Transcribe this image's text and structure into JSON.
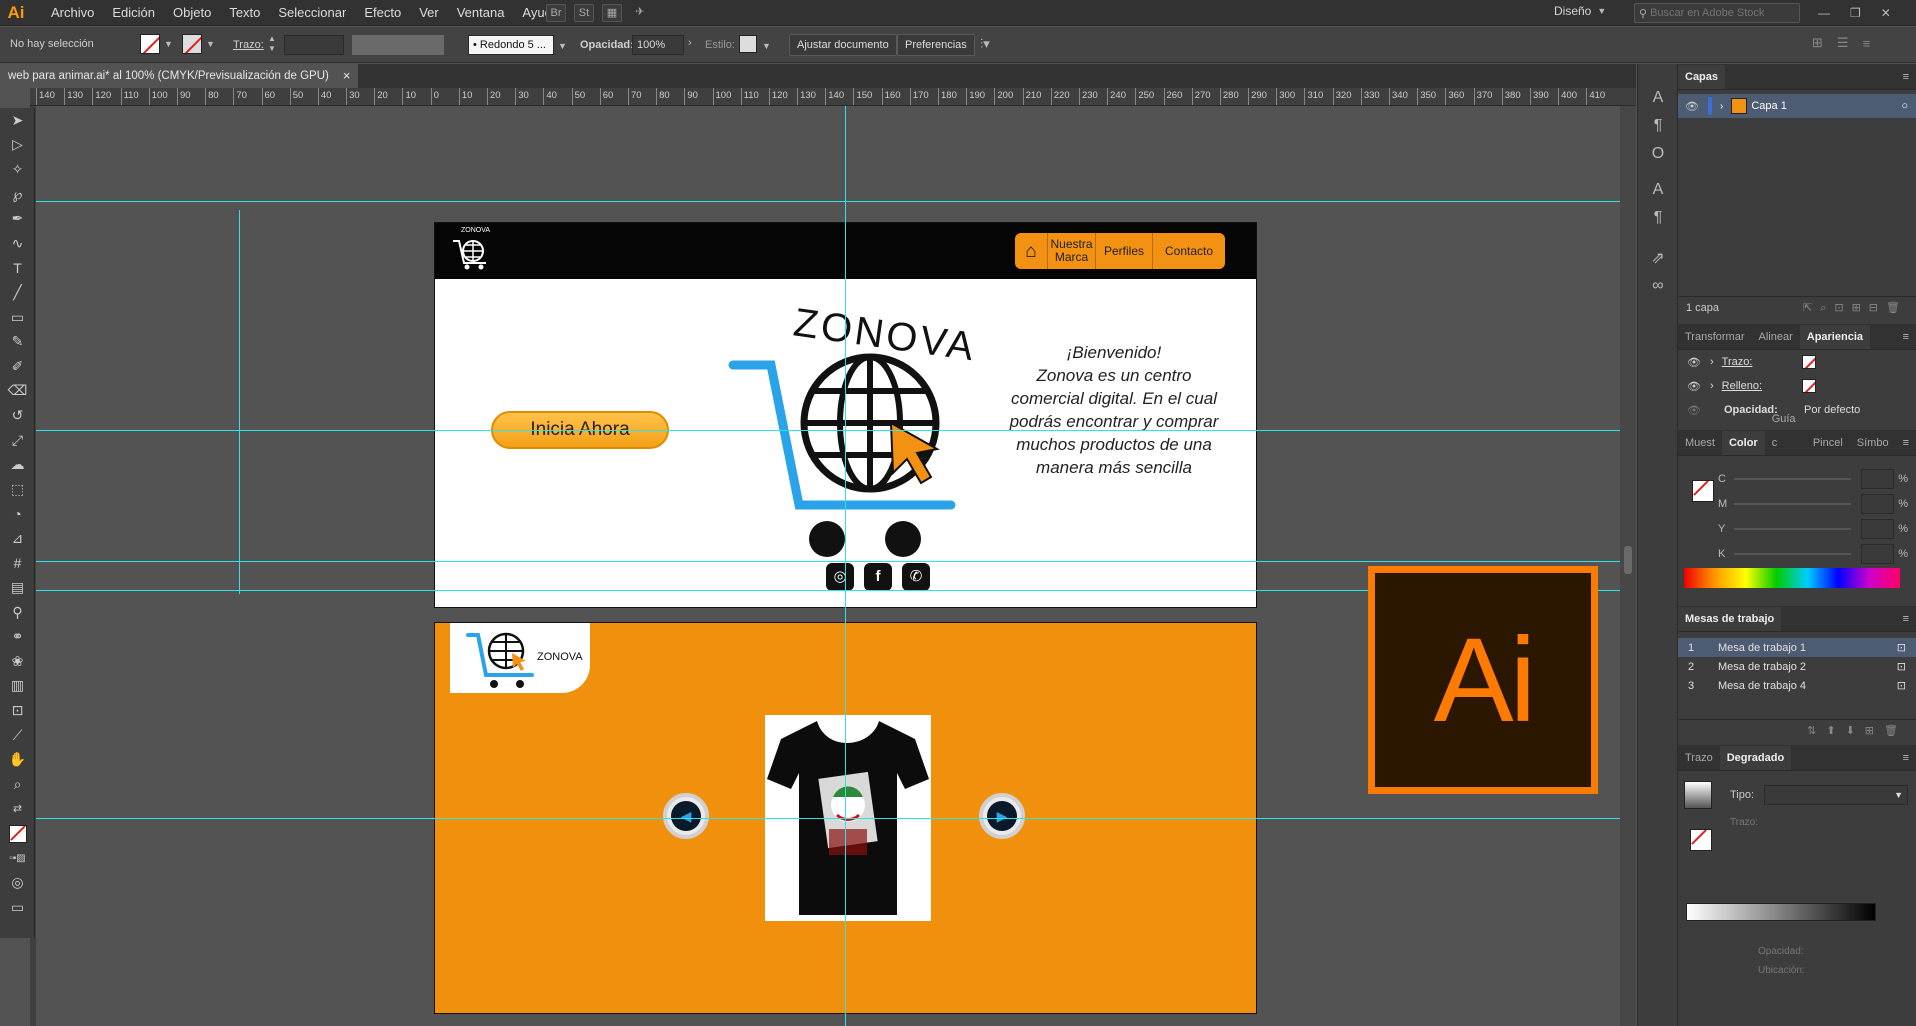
{
  "app": {
    "logo": "Ai",
    "menu": [
      "Archivo",
      "Edición",
      "Objeto",
      "Texto",
      "Seleccionar",
      "Efecto",
      "Ver",
      "Ventana",
      "Ayuda"
    ],
    "workspace": "Diseño",
    "search_placeholder": "Buscar en Adobe Stock",
    "bridge_label": "Br",
    "stock_label": "St"
  },
  "control": {
    "selection": "No hay selección",
    "stroke_label": "Trazo:",
    "brush": "Redondo 5 ...",
    "opacity_label": "Opacidad:",
    "opacity_value": "100%",
    "style_label": "Estilo:",
    "fit_button": "Ajustar documento",
    "prefs_button": "Preferencias"
  },
  "document": {
    "tab_title": "web para animar.ai* al 100% (CMYK/Previsualización de GPU)",
    "close": "×"
  },
  "ruler": {
    "ticks": [
      "140",
      "130",
      "120",
      "110",
      "100",
      "90",
      "80",
      "70",
      "60",
      "50",
      "40",
      "30",
      "20",
      "10",
      "0",
      "10",
      "20",
      "30",
      "40",
      "50",
      "60",
      "70",
      "80",
      "90",
      "100",
      "110",
      "120",
      "130",
      "140",
      "150",
      "160",
      "170",
      "180",
      "190",
      "200",
      "210",
      "220",
      "230",
      "240",
      "250",
      "260",
      "270",
      "280",
      "290",
      "300",
      "310",
      "320",
      "330",
      "340",
      "350",
      "360",
      "370",
      "380",
      "390",
      "400",
      "410"
    ]
  },
  "artboard1": {
    "nav": [
      "Nuestra Marca",
      "Perfiles",
      "Contacto"
    ],
    "cta": "Inicia Ahora",
    "wordmark": "ZONOVA",
    "welcome_title": "¡Bienvenido!",
    "welcome_text": "Zonova es un centro comercial digital. En el cual podrás encontrar y comprar muchos productos de una manera más sencilla",
    "header_logo_text": "ZONOVA"
  },
  "artboard2": {
    "logo_text": "ZONOVA"
  },
  "badge": {
    "text": "Ai"
  },
  "layers": {
    "tab": "Capas",
    "items": [
      {
        "name": "Capa 1"
      }
    ],
    "count": "1 capa"
  },
  "appearance": {
    "tabs": [
      "Transformar",
      "Alinear",
      "Apariencia"
    ],
    "rows": [
      {
        "label": "Trazo:"
      },
      {
        "label": "Relleno:"
      },
      {
        "label": "Opacidad:",
        "value": "Por defecto"
      }
    ]
  },
  "color": {
    "tabs": [
      "Muest",
      "Color",
      "Guía c",
      "Pincel",
      "Símbo"
    ],
    "channels": [
      "C",
      "M",
      "Y",
      "K"
    ],
    "unit": "%"
  },
  "artboards_panel": {
    "title": "Mesas de trabajo",
    "items": [
      {
        "num": "1",
        "name": "Mesa de trabajo 1"
      },
      {
        "num": "2",
        "name": "Mesa de trabajo 2"
      },
      {
        "num": "3",
        "name": "Mesa de trabajo 4"
      }
    ]
  },
  "gradient": {
    "tabs": [
      "Trazo",
      "Degradado"
    ],
    "type_label": "Tipo:",
    "stroke_label": "Trazo:",
    "opacity_label": "Opacidad:",
    "location_label": "Ubicación:"
  },
  "colors": {
    "accent_orange": "#f39112",
    "guide": "#2ee3e3",
    "selection_blue": "#4d5c73",
    "cart_blue": "#2aa3e8"
  },
  "icons": [
    "selection-tool-icon",
    "direct-selection-icon",
    "magic-wand-icon",
    "lasso-icon",
    "pen-icon",
    "curvature-icon",
    "type-icon",
    "line-icon",
    "rectangle-icon",
    "paintbrush-icon",
    "shaper-icon",
    "eraser-icon",
    "rotate-icon",
    "scale-icon",
    "warp-icon",
    "free-transform-icon",
    "shape-builder-icon",
    "perspective-icon",
    "mesh-icon",
    "gradient-icon",
    "eyedropper-icon",
    "blend-icon",
    "symbol-sprayer-icon",
    "graph-icon",
    "artboard-icon",
    "slice-icon",
    "hand-icon",
    "zoom-icon"
  ]
}
